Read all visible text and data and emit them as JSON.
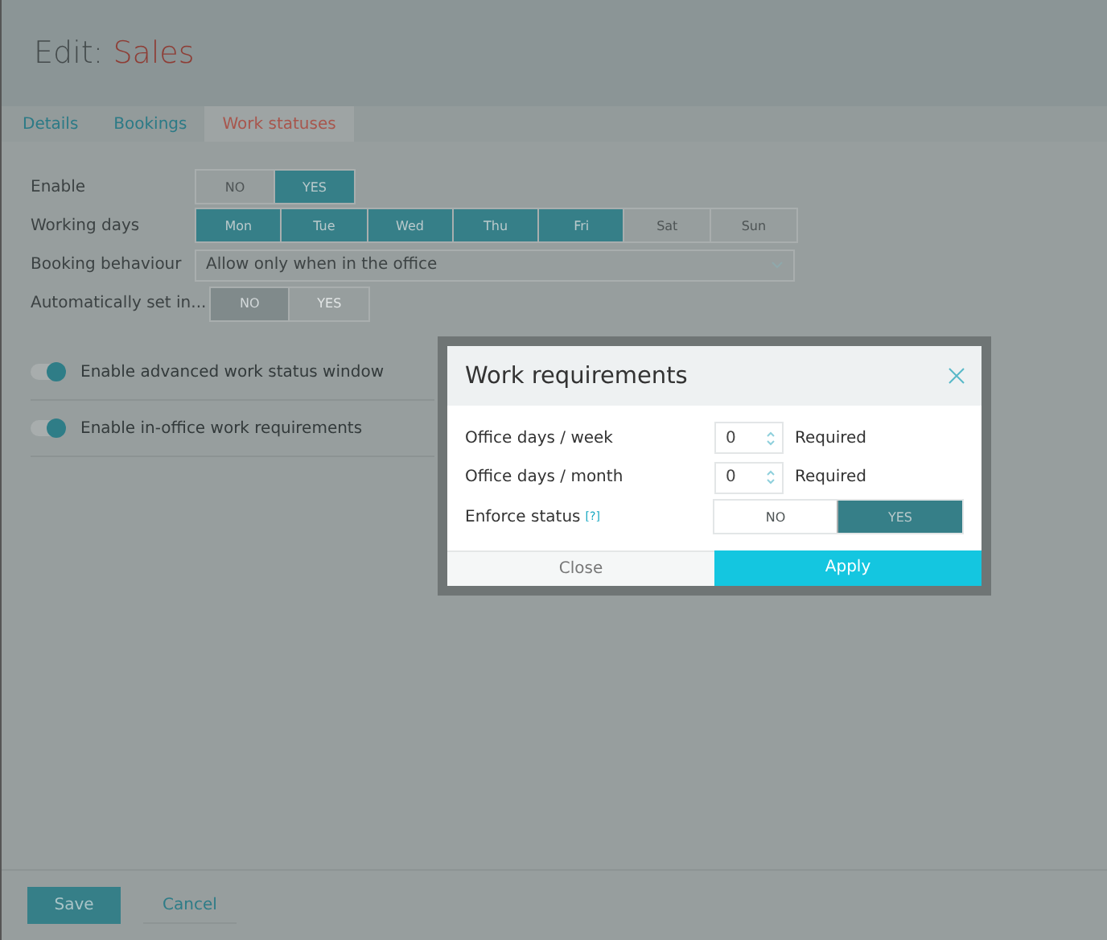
{
  "header": {
    "prefix": "Edit:",
    "name": "Sales"
  },
  "tabs": [
    {
      "label": "Details",
      "selected": false
    },
    {
      "label": "Bookings",
      "selected": false
    },
    {
      "label": "Work statuses",
      "selected": true
    }
  ],
  "settings": {
    "enable": {
      "label": "Enable",
      "options": [
        {
          "label": "NO",
          "selected": false
        },
        {
          "label": "YES",
          "selected": true
        }
      ]
    },
    "working_days": {
      "label": "Working days",
      "days": [
        {
          "label": "Mon",
          "selected": true
        },
        {
          "label": "Tue",
          "selected": true
        },
        {
          "label": "Wed",
          "selected": true
        },
        {
          "label": "Thu",
          "selected": true
        },
        {
          "label": "Fri",
          "selected": true
        },
        {
          "label": "Sat",
          "selected": false
        },
        {
          "label": "Sun",
          "selected": false
        }
      ]
    },
    "booking_behaviour": {
      "label": "Booking behaviour",
      "value": "Allow only when in the office"
    },
    "auto_set": {
      "label": "Automatically set in...",
      "disabled": true,
      "options": [
        {
          "label": "NO",
          "selected": true
        },
        {
          "label": "YES",
          "selected": false
        }
      ]
    }
  },
  "toggles": [
    {
      "label": "Enable advanced work status window",
      "on": true
    },
    {
      "label": "Enable in-office work requirements",
      "on": true
    }
  ],
  "modal": {
    "title": "Work requirements",
    "fields": [
      {
        "label": "Office days / week",
        "value": "0",
        "suffix": "Required"
      },
      {
        "label": "Office days / month",
        "value": "0",
        "suffix": "Required"
      }
    ],
    "enforce": {
      "label": "Enforce status",
      "help": "[?]",
      "options": [
        {
          "label": "NO",
          "selected": false
        },
        {
          "label": "YES",
          "selected": true
        }
      ]
    },
    "buttons": {
      "close": "Close",
      "apply": "Apply"
    }
  },
  "footer": {
    "save": "Save",
    "cancel": "Cancel"
  }
}
